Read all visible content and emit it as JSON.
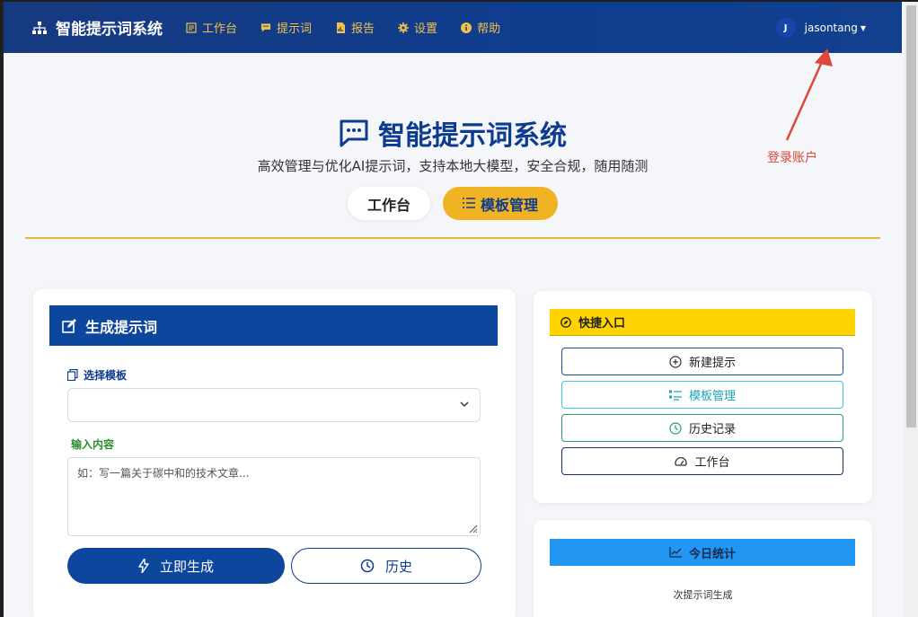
{
  "navbar": {
    "brand": "智能提示词系统",
    "items": [
      {
        "label": "工作台",
        "icon": "document-icon"
      },
      {
        "label": "提示词",
        "icon": "comment-icon"
      },
      {
        "label": "报告",
        "icon": "chart-file-icon"
      },
      {
        "label": "设置",
        "icon": "gear-icon"
      },
      {
        "label": "帮助",
        "icon": "info-icon"
      }
    ],
    "user": {
      "avatar_letter": "J",
      "name": "jasontang"
    }
  },
  "hero": {
    "title": "智能提示词系统",
    "subtitle": "高效管理与优化AI提示词，支持本地大模型，安全合规，随用随测",
    "tabs": [
      "工作台",
      "模板管理"
    ]
  },
  "annotation": {
    "text": "登录账户",
    "color": "#e0473b"
  },
  "generate_card": {
    "title": "生成提示词",
    "template_label": "选择模板",
    "template_value": "",
    "input_label": "输入内容",
    "input_placeholder": "如：写一篇关于碳中和的技术文章...",
    "generate_button": "立即生成",
    "history_button": "历史"
  },
  "quick_card": {
    "title": "快捷入口",
    "buttons": [
      "新建提示",
      "模板管理",
      "历史记录",
      "工作台"
    ]
  },
  "stats_card": {
    "title": "今日统计",
    "text": "次提示词生成"
  },
  "colors": {
    "navy": "#0d469d",
    "gold": "#f0b323",
    "yellow": "#ffd400",
    "blue": "#2196f3",
    "annotation_red": "#e0473b"
  }
}
